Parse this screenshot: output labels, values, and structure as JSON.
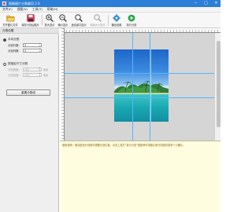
{
  "window": {
    "title": "图像图片分割裁切 2.0",
    "minimize_glyph": "─",
    "maximize_glyph": "□",
    "close_glyph": "✕"
  },
  "menu": [
    "文件(F)",
    "视图(V)",
    "工具(T)",
    "帮助(H)"
  ],
  "toolbar": {
    "open_label": "打开图片文件",
    "save_label": "保存分割后图片",
    "zoom_in_label": "放大显示",
    "zoom_out_label": "缩小显示",
    "fit_label": "适合窗口显示",
    "actual_label": "原始大小显示",
    "settings_label": "输出设置",
    "split_label": "执行分割"
  },
  "panel": {
    "title": "分割设置",
    "mode_average_label": "平均分割",
    "rows_label": "分割行数：",
    "rows_value": "3",
    "cols_label": "分割列数：",
    "cols_value": "3",
    "mode_size_label": "按指定尺寸分割",
    "width_label": "分割宽度：",
    "width_value": "100",
    "height_label": "分割高度：",
    "height_value": "100",
    "unit_label": "像素",
    "reset_label": "重置分割线"
  },
  "info": {
    "text": "使用说明：拖动蓝色分割线可调整分割位置；点击工具栏“执行分割”按钮即可将图片按分割线切成多个小图片。"
  },
  "colors": {
    "titlebar": "#2b7fd6",
    "guide": "#55b4ff",
    "workspace": "#d5d5d5",
    "info_background": "#fffde0"
  },
  "icons": {
    "open": "folder-open-icon",
    "save": "save-icon",
    "zoom_in": "zoom-in-icon",
    "zoom_out": "zoom-out-icon",
    "fit": "zoom-fit-icon",
    "actual": "zoom-actual-icon",
    "settings": "gear-icon",
    "split": "play-icon"
  }
}
